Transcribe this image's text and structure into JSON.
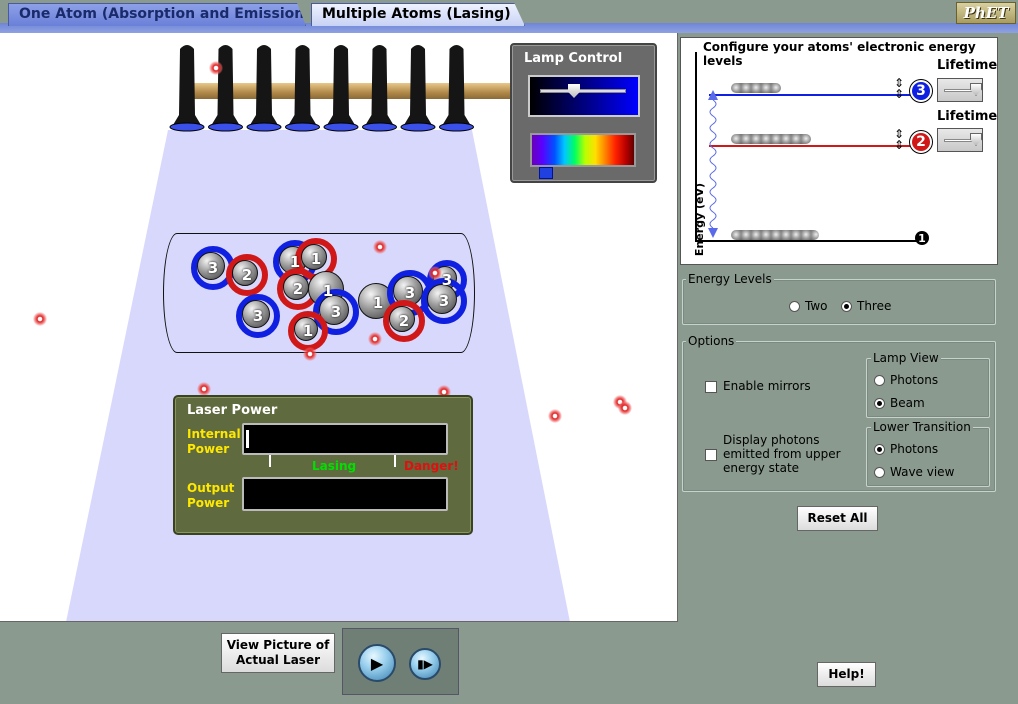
{
  "tabs": [
    {
      "label": "One Atom (Absorption and Emission)",
      "active": false
    },
    {
      "label": "Multiple Atoms (Lasing)",
      "active": true
    }
  ],
  "logo": "PhET",
  "lamp_control": {
    "title": "Lamp Control",
    "intensity_value": 0.35,
    "wavelength_value": 0.1
  },
  "tube_atoms": [
    {
      "label": "3",
      "ring": "blue"
    },
    {
      "label": "2",
      "ring": "red"
    },
    {
      "label": "3",
      "ring": "blue"
    },
    {
      "label": "1",
      "ring": "blue"
    },
    {
      "label": "1",
      "ring": "red"
    },
    {
      "label": "2",
      "ring": "red"
    },
    {
      "label": "1",
      "ring": "none"
    },
    {
      "label": "3",
      "ring": "blue"
    },
    {
      "label": "1",
      "ring": "red"
    },
    {
      "label": "1",
      "ring": "none"
    },
    {
      "label": "3",
      "ring": "blue"
    },
    {
      "label": "2",
      "ring": "red"
    },
    {
      "label": "3",
      "ring": "blue"
    },
    {
      "label": "3",
      "ring": "blue"
    }
  ],
  "laser_power": {
    "title": "Laser Power",
    "internal_label": "Internal Power",
    "output_label": "Output Power",
    "lasing_label": "Lasing",
    "danger_label": "Danger!"
  },
  "energy_panel": {
    "title": "Configure your atoms' electronic energy levels",
    "axis_label": "Energy (eV)",
    "lifetime_label_1": "Lifetime",
    "lifetime_label_2": "Lifetime",
    "level_3": "3",
    "level_2": "2",
    "level_1": "1",
    "level_3_count": 5,
    "level_2_count": 8,
    "level_1_count": 9
  },
  "energy_levels": {
    "legend": "Energy Levels",
    "options": [
      "Two",
      "Three"
    ],
    "selected": "Three"
  },
  "options": {
    "legend": "Options",
    "enable_mirrors": "Enable mirrors",
    "display_photons": "Display photons emitted from upper energy state",
    "lamp_view": {
      "legend": "Lamp View",
      "options": [
        "Photons",
        "Beam"
      ],
      "selected": "Beam"
    },
    "lower_transition": {
      "legend": "Lower Transition",
      "options": [
        "Photons",
        "Wave view"
      ],
      "selected": "Photons"
    }
  },
  "buttons": {
    "reset_all": "Reset All",
    "view_picture": "View Picture of Actual Laser",
    "help": "Help!"
  },
  "colors": {
    "level3": "#1020e0",
    "level2": "#d01818",
    "beam": "#d8d8fc",
    "lasing": "#00e000",
    "danger": "#e01010"
  }
}
